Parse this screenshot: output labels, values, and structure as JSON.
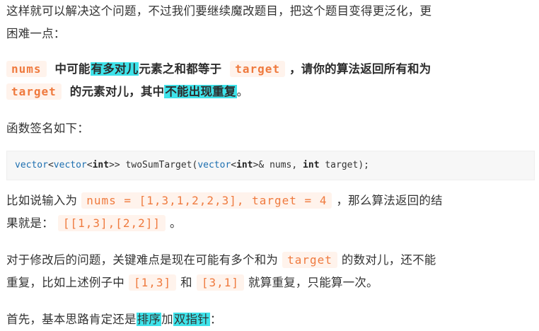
{
  "para1": {
    "line1": "这样就可以解决这个问题，不过我们要继续魔改题目，把这个题目变得更泛化，更",
    "line2": "困难一点："
  },
  "para2": {
    "code_nums": "nums",
    "t1": "中可能",
    "hl1": "有多对儿",
    "t2": "元素之和都等于",
    "code_target": "target",
    "t3": "，请你的算法返回所有和为",
    "code_target2": "target",
    "t4": "的元素对儿，其中",
    "hl2": "不能出现重复",
    "t5": "。"
  },
  "para3": "函数签名如下：",
  "code": {
    "v1": "vector",
    "lt1": "<",
    "v2": "vector",
    "lt2": "<",
    "int1": "int",
    "rest1": ">> twoSumTarget(",
    "v3": "vector",
    "lt3": "<",
    "int2": "int",
    "rest2": ">& nums, ",
    "int3": "int",
    "rest3": " target);"
  },
  "para4": {
    "t1": "比如说输入为",
    "code1": "nums = [1,3,1,2,2,3], target = 4",
    "t2": "，那么算法返回的结",
    "t3": "果就是：",
    "code2": "[[1,3],[2,2]]",
    "t4": "。"
  },
  "para5": {
    "t1": "对于修改后的问题，关键难点是现在可能有多个和为",
    "code1": "target",
    "t2": "的数对儿，还不能",
    "t3": "重复，比如上述例子中",
    "code2": "[1,3]",
    "t4": "和",
    "code3": "[3,1]",
    "t5": "就算重复，只能算一次。"
  },
  "para6": {
    "t1": "首先，基本思路肯定还是",
    "hl1": "排序",
    "t2": "加",
    "hl2": "双指针",
    "t3": "："
  }
}
